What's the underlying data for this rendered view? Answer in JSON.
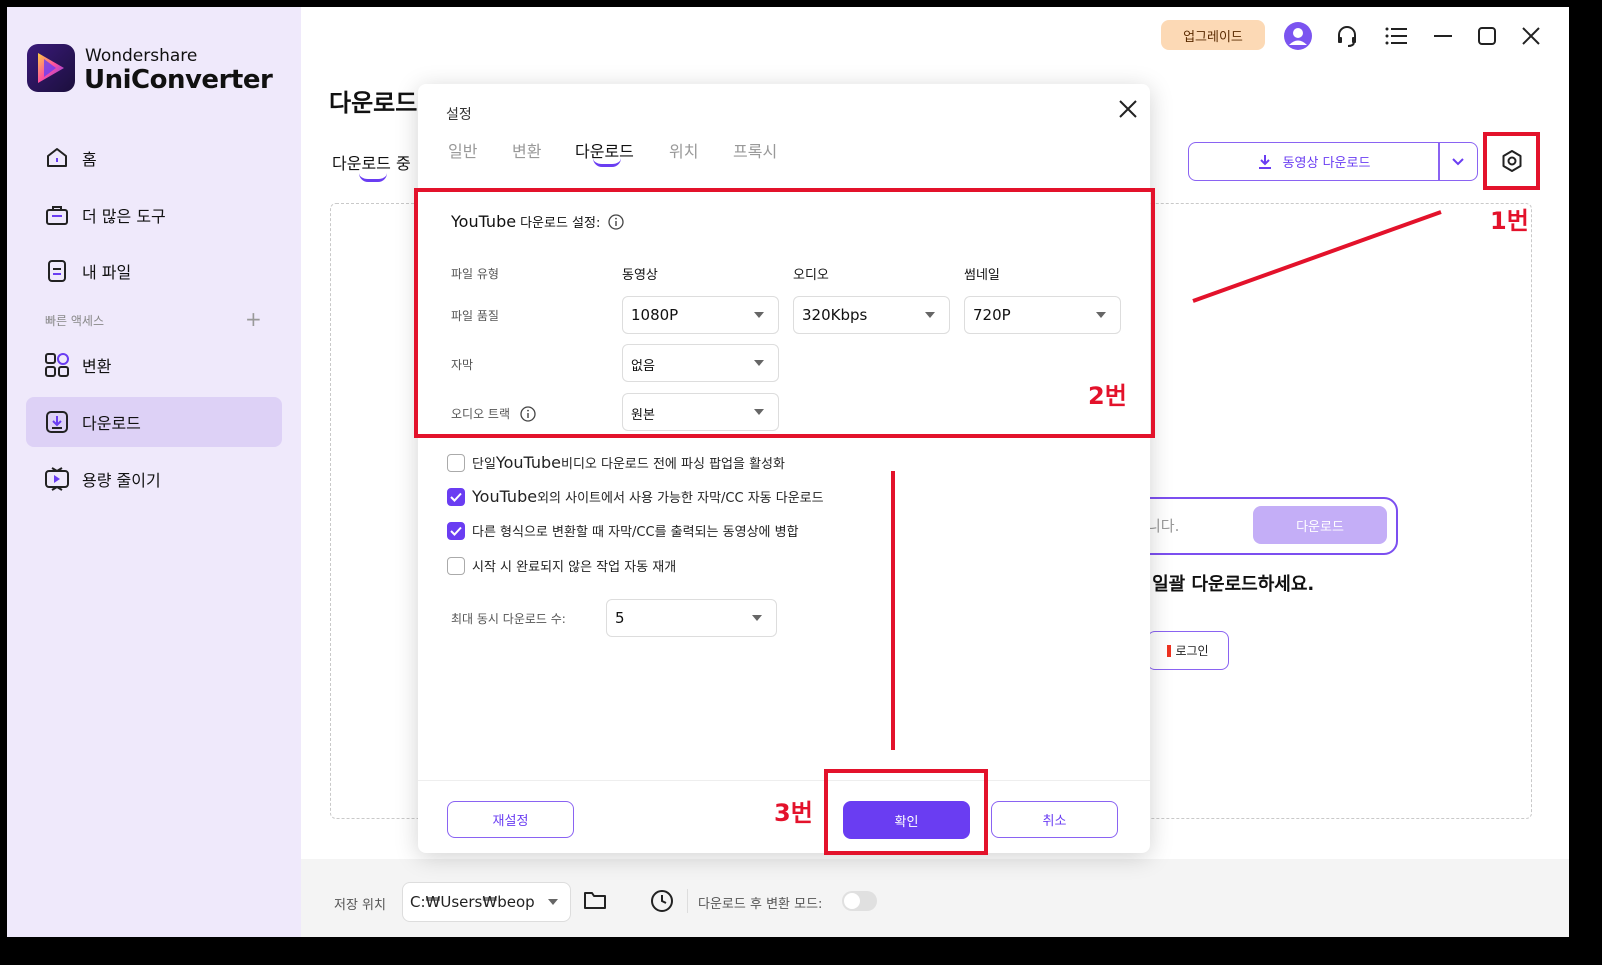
{
  "brand": {
    "line1": "Wondershare",
    "line2": "UniConverter"
  },
  "sidebar": {
    "items": [
      {
        "label": "홈",
        "icon": "home-icon"
      },
      {
        "label": "더 많은 도구",
        "icon": "toolbox-icon"
      },
      {
        "label": "내 파일",
        "icon": "file-icon"
      },
      {
        "label": "변환",
        "icon": "convert-icon"
      },
      {
        "label": "다운로드",
        "icon": "download-icon",
        "active": true
      },
      {
        "label": "용량 줄이기",
        "icon": "compress-icon"
      }
    ],
    "quick_access": "빠른 액세스",
    "quick_add": "+"
  },
  "header": {
    "upgrade": "업그레이드"
  },
  "main": {
    "title": "다운로드",
    "tab": "다운로드 중",
    "download_video_button": "동영상 다운로드",
    "url_hint": "니다.",
    "url_button": "다운로드",
    "bulk_text": "· 일괄 다운로드하세요.",
    "login_button": "로그인"
  },
  "bottom": {
    "save_label": "저장 위치",
    "save_path": "C:₩Users₩beop",
    "after_label": "다운로드 후 변환 모드:"
  },
  "dialog": {
    "title": "설정",
    "tabs": [
      "일반",
      "변환",
      "다운로드",
      "위치",
      "프록시"
    ],
    "active_tab": "다운로드",
    "youtube_heading": "YouTube",
    "youtube_heading_suffix": "다운로드 설정:",
    "file_type_label": "파일 유형",
    "columns": [
      "동영상",
      "오디오",
      "썸네일"
    ],
    "file_quality_label": "파일 품질",
    "quality": {
      "video": "1080P",
      "audio": "320Kbps",
      "thumbnail": "720P"
    },
    "subtitle_label": "자막",
    "subtitle_value": "없음",
    "audio_track_label": "오디오 트랙",
    "audio_track_value": "원본",
    "checkboxes": [
      {
        "pre": "단일 ",
        "big": "YouTube",
        "post": " 비디오 다운로드 전에 파싱 팝업을 활성화",
        "checked": false
      },
      {
        "pre": "",
        "big": "YouTube",
        "post": " 외의 사이트에서 사용 가능한 자막/CC 자동 다운로드",
        "checked": true
      },
      {
        "pre": "다른 형식으로 변환할 때 자막/CC를 출력되는 동영상에 병합",
        "big": "",
        "post": "",
        "checked": true
      },
      {
        "pre": "시작 시 완료되지 않은 작업 자동 재개",
        "big": "",
        "post": "",
        "checked": false
      }
    ],
    "max_concurrent_label": "최대 동시 다운로드 수:",
    "max_concurrent_value": "5",
    "reset_button": "재설정",
    "ok_button": "확인",
    "cancel_button": "취소"
  },
  "annotations": {
    "label1": "1번",
    "label2": "2번",
    "label3": "3번",
    "color": "#e3122b"
  },
  "colors": {
    "accent": "#6a3df2",
    "sidebar_bg": "#efe9fb",
    "upgrade_bg": "#fcd9b5"
  }
}
